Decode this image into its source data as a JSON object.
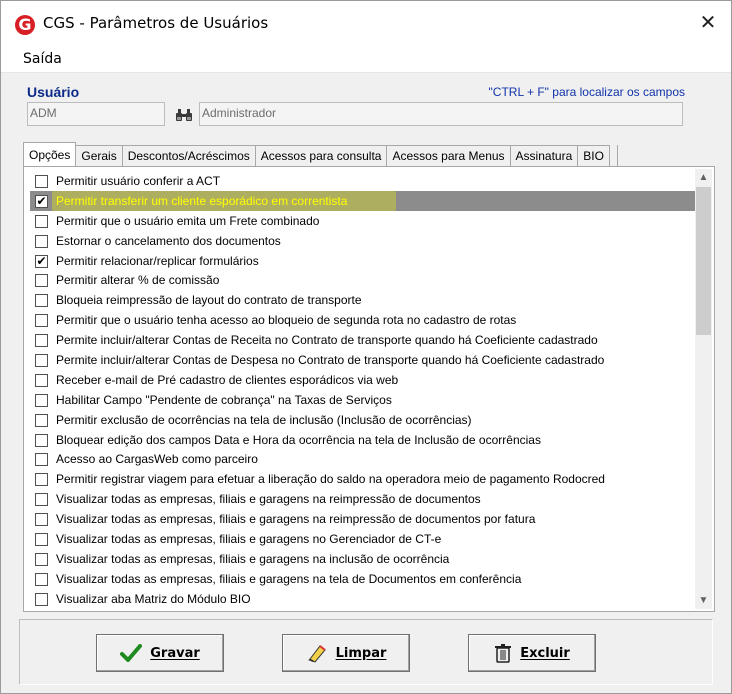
{
  "window": {
    "title": "CGS - Parâmetros de Usuários",
    "logo_letter": "G",
    "close_glyph": "✕"
  },
  "menu": {
    "items": [
      "Saída"
    ]
  },
  "user": {
    "label": "Usuário",
    "hint": "\"CTRL + F\" para localizar os campos",
    "code": "ADM",
    "name": "Administrador"
  },
  "tabs": [
    {
      "label": "Opções",
      "active": true
    },
    {
      "label": "Gerais"
    },
    {
      "label": "Descontos/Acréscimos"
    },
    {
      "label": "Acessos para consulta"
    },
    {
      "label": "Acessos para Menus"
    },
    {
      "label": "Assinatura"
    },
    {
      "label": "BIO"
    }
  ],
  "options": [
    {
      "label": "Permitir usuário conferir a ACT",
      "checked": false
    },
    {
      "label": "Permitir transferir um cliente esporádico em correntista",
      "checked": true,
      "selected": true,
      "highlighted": true
    },
    {
      "label": "Permitir que o usuário emita um Frete combinado",
      "checked": false
    },
    {
      "label": "Estornar o cancelamento dos documentos",
      "checked": false
    },
    {
      "label": "Permitir relacionar/replicar  formulários",
      "checked": true
    },
    {
      "label": "Permitir alterar % de comissão",
      "checked": false
    },
    {
      "label": "Bloqueia reimpressão de layout do contrato de transporte",
      "checked": false
    },
    {
      "label": "Permitir que o usuário tenha acesso ao bloqueio de segunda rota no cadastro de rotas",
      "checked": false
    },
    {
      "label": "Permite incluir/alterar Contas de Receita no Contrato de transporte quando há Coeficiente cadastrado",
      "checked": false
    },
    {
      "label": "Permite incluir/alterar Contas de Despesa no Contrato de transporte quando há Coeficiente cadastrado",
      "checked": false
    },
    {
      "label": "Receber e-mail de Pré cadastro de clientes esporádicos via web",
      "checked": false
    },
    {
      "label": "Habilitar Campo \"Pendente de cobrança\" na Taxas de Serviços",
      "checked": false
    },
    {
      "label": "Permitir exclusão de ocorrências na tela de inclusão (Inclusão de ocorrências)",
      "checked": false
    },
    {
      "label": "Bloquear edição dos campos Data e Hora da ocorrência na tela de Inclusão de ocorrências",
      "checked": false
    },
    {
      "label": "Acesso ao CargasWeb como parceiro",
      "checked": false
    },
    {
      "label": "Permitir registrar viagem para efetuar a liberação do saldo na operadora meio de pagamento Rodocred",
      "checked": false
    },
    {
      "label": "Visualizar todas as empresas, filiais e garagens na reimpressão de documentos",
      "checked": false
    },
    {
      "label": "Visualizar todas as empresas, filiais e garagens na reimpressão de documentos por fatura",
      "checked": false
    },
    {
      "label": "Visualizar todas as empresas, filiais e garagens no Gerenciador de CT-e",
      "checked": false
    },
    {
      "label": "Visualizar todas as empresas, filiais e garagens na inclusão de ocorrência",
      "checked": false
    },
    {
      "label": "Visualizar todas as empresas, filiais e garagens na tela de Documentos em conferência",
      "checked": false
    },
    {
      "label": "Visualizar aba Matriz do Módulo BIO",
      "checked": false
    }
  ],
  "buttons": {
    "gravar": {
      "label": "Gravar",
      "icon": "checkmark-icon"
    },
    "limpar": {
      "label": "Limpar",
      "icon": "eraser-icon"
    },
    "excluir": {
      "label": "Excluir",
      "icon": "trash-icon"
    }
  },
  "colors": {
    "user_label": "#0b2a8a",
    "selected_row_bg": "#8c8c8c",
    "selected_row_text": "#ffff00",
    "highlight": "#ffff00",
    "logo": "#d81f26"
  }
}
